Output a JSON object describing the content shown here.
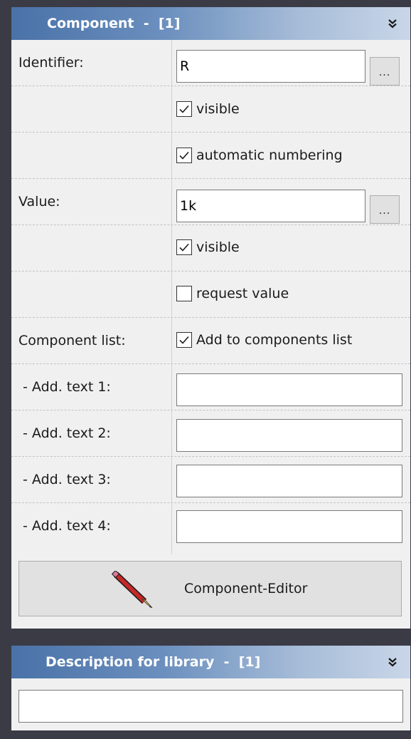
{
  "component_panel": {
    "title": "Component  -  [1]",
    "collapse_icon": "double-chevron-down-icon",
    "identifier_label": "Identifier:",
    "identifier_value": "R",
    "identifier_browse": "...",
    "identifier_visible_label": "visible",
    "identifier_visible_checked": true,
    "auto_numbering_label": "automatic numbering",
    "auto_numbering_checked": true,
    "value_label": "Value:",
    "value_value": "1k",
    "value_browse": "...",
    "value_visible_label": "visible",
    "value_visible_checked": true,
    "request_value_label": "request value",
    "request_value_checked": false,
    "component_list_label": "Component list:",
    "add_to_list_label": "Add to components list",
    "add_to_list_checked": true,
    "add_text_1_label": " - Add. text 1:",
    "add_text_1_value": "",
    "add_text_2_label": " - Add. text 2:",
    "add_text_2_value": "",
    "add_text_3_label": " - Add. text 3:",
    "add_text_3_value": "",
    "add_text_4_label": " - Add. text 4:",
    "add_text_4_value": "",
    "editor_button_label": "Component-Editor",
    "editor_button_icon": "pencil-icon"
  },
  "description_panel": {
    "title": "Description for library  -  [1]",
    "collapse_icon": "double-chevron-down-icon",
    "description_value": ""
  }
}
